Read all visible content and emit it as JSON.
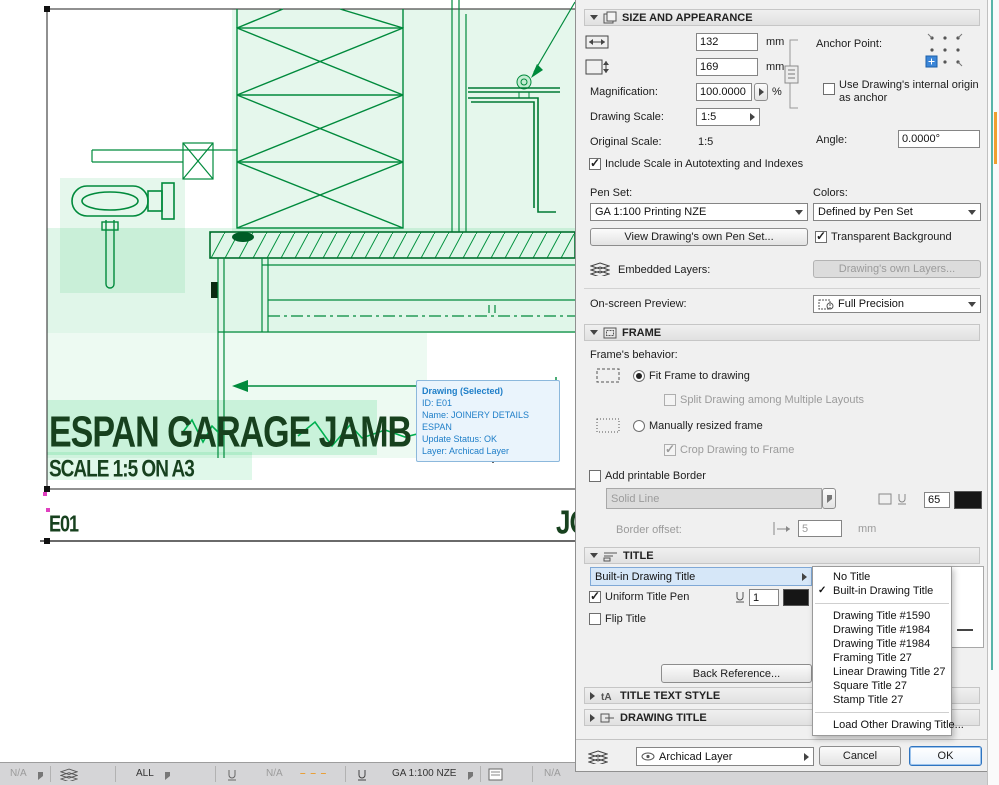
{
  "panel": {
    "size_section": {
      "header": "SIZE AND APPEARANCE",
      "width": {
        "value": "132",
        "unit": "mm"
      },
      "height": {
        "value": "169",
        "unit": "mm"
      },
      "magnification": {
        "label": "Magnification:",
        "value": "100.0000",
        "unit": "%"
      },
      "drawing_scale": {
        "label": "Drawing Scale:",
        "value": "1:5"
      },
      "original_scale": {
        "label": "Original Scale:",
        "value": "1:5"
      },
      "include_scale": "Include Scale in Autotexting and Indexes",
      "anchor_point_label": "Anchor Point:",
      "use_origin": "Use Drawing's internal origin as anchor",
      "angle": {
        "label": "Angle:",
        "value": "0.0000°"
      },
      "pen_set": {
        "label": "Pen Set:",
        "value": "GA 1:100 Printing NZE"
      },
      "colors": {
        "label": "Colors:",
        "value": "Defined by Pen Set"
      },
      "view_pen_set": "View Drawing's own Pen Set...",
      "transparent_bg": "Transparent Background",
      "embedded_layers_label": "Embedded Layers:",
      "own_layers": "Drawing's own Layers...",
      "preview": {
        "label": "On-screen Preview:",
        "value": "Full Precision"
      }
    },
    "frame_section": {
      "header": "FRAME",
      "behavior_label": "Frame's behavior:",
      "fit": "Fit Frame to drawing",
      "split": "Split Drawing among Multiple Layouts",
      "manual": "Manually resized frame",
      "crop": "Crop Drawing to Frame",
      "add_border": "Add printable Border",
      "line_type": "Solid Line",
      "border_pen": "65",
      "border_offset": {
        "label": "Border offset:",
        "value": "5",
        "unit": "mm"
      }
    },
    "title_section": {
      "header": "TITLE",
      "selected_title": "Built-in Drawing Title",
      "uniform_pen": "Uniform Title Pen",
      "pen_value": "1",
      "flip": "Flip Title",
      "back_reference": "Back Reference..."
    },
    "text_style_section": {
      "header": "TITLE TEXT STYLE"
    },
    "drawing_title_section": {
      "header": "DRAWING TITLE"
    },
    "footer": {
      "layer": "Archicad Layer",
      "cancel": "Cancel",
      "ok": "OK"
    }
  },
  "menu": {
    "check": "✓",
    "items": [
      "No Title",
      "Built-in Drawing Title",
      "Drawing Title #1590",
      "Drawing Title #1984",
      "Drawing Title #1984",
      "Framing Title 27",
      "Linear Drawing Title 27",
      "Square Title 27",
      "Stamp Title 27",
      "Load Other Drawing Title..."
    ]
  },
  "drawing": {
    "title": "ESPAN GARAGE JAMB",
    "subtitle": "SCALE 1:5 ON A3",
    "ref": "E01",
    "clipped_title": "JO",
    "tooltip": {
      "title": "Drawing (Selected)",
      "id": "ID: E01",
      "name": "Name: JOINERY DETAILS ESPAN",
      "status": "Update Status: OK",
      "layer": "Layer: Archicad Layer"
    }
  },
  "statusbar": {
    "items": [
      "N/A",
      "ALL",
      "N/A",
      "GA 1:100 NZE",
      "N/A"
    ],
    "dashes": "– – –"
  }
}
